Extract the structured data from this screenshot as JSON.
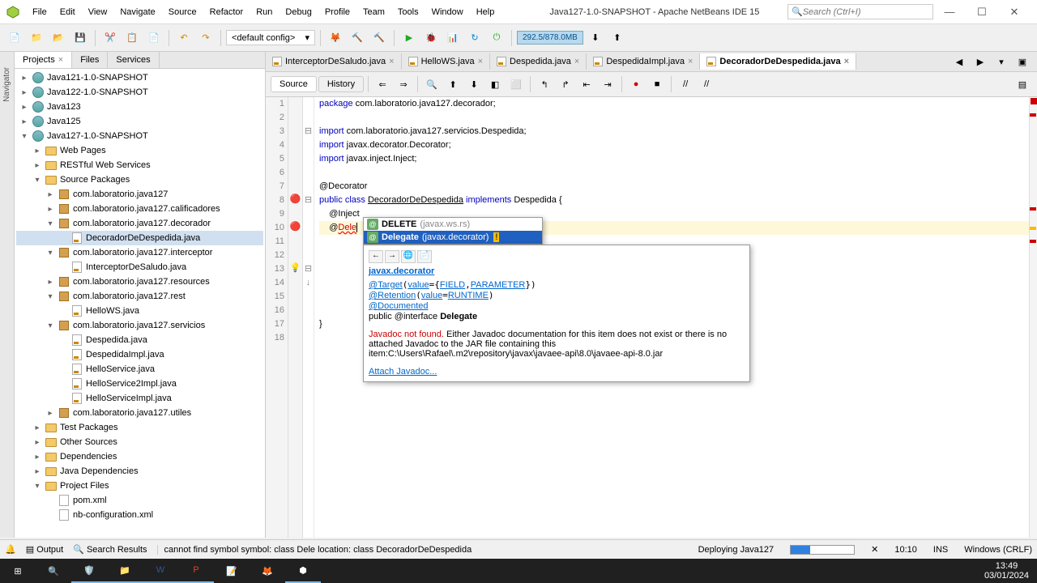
{
  "titlebar": {
    "menus": [
      "File",
      "Edit",
      "View",
      "Navigate",
      "Source",
      "Refactor",
      "Run",
      "Debug",
      "Profile",
      "Team",
      "Tools",
      "Window",
      "Help"
    ],
    "title": "Java127-1.0-SNAPSHOT - Apache NetBeans IDE 15",
    "search_placeholder": "Search (Ctrl+I)"
  },
  "toolbar": {
    "config": "<default config>",
    "memory": "292.5/878.0MB"
  },
  "panel_tabs": {
    "projects": "Projects",
    "files": "Files",
    "services": "Services"
  },
  "tree": [
    {
      "l": 0,
      "t": "e",
      "k": "proj",
      "n": "Java121-1.0-SNAPSHOT"
    },
    {
      "l": 0,
      "t": "e",
      "k": "proj",
      "n": "Java122-1.0-SNAPSHOT"
    },
    {
      "l": 0,
      "t": "e",
      "k": "proj",
      "n": "Java123"
    },
    {
      "l": 0,
      "t": "e",
      "k": "proj",
      "n": "Java125"
    },
    {
      "l": 0,
      "t": "o",
      "k": "proj",
      "n": "Java127-1.0-SNAPSHOT"
    },
    {
      "l": 1,
      "t": "e",
      "k": "folder",
      "n": "Web Pages"
    },
    {
      "l": 1,
      "t": "e",
      "k": "folder",
      "n": "RESTful Web Services"
    },
    {
      "l": 1,
      "t": "o",
      "k": "folder",
      "n": "Source Packages"
    },
    {
      "l": 2,
      "t": "e",
      "k": "pkg",
      "n": "com.laboratorio.java127"
    },
    {
      "l": 2,
      "t": "e",
      "k": "pkg",
      "n": "com.laboratorio.java127.calificadores"
    },
    {
      "l": 2,
      "t": "o",
      "k": "pkg",
      "n": "com.laboratorio.java127.decorador"
    },
    {
      "l": 3,
      "t": "",
      "k": "java",
      "n": "DecoradorDeDespedida.java",
      "sel": true
    },
    {
      "l": 2,
      "t": "o",
      "k": "pkg",
      "n": "com.laboratorio.java127.interceptor"
    },
    {
      "l": 3,
      "t": "",
      "k": "java",
      "n": "InterceptorDeSaludo.java"
    },
    {
      "l": 2,
      "t": "e",
      "k": "pkg",
      "n": "com.laboratorio.java127.resources"
    },
    {
      "l": 2,
      "t": "o",
      "k": "pkg",
      "n": "com.laboratorio.java127.rest"
    },
    {
      "l": 3,
      "t": "",
      "k": "java",
      "n": "HelloWS.java"
    },
    {
      "l": 2,
      "t": "o",
      "k": "pkg",
      "n": "com.laboratorio.java127.servicios"
    },
    {
      "l": 3,
      "t": "",
      "k": "java",
      "n": "Despedida.java"
    },
    {
      "l": 3,
      "t": "",
      "k": "java",
      "n": "DespedidaImpl.java"
    },
    {
      "l": 3,
      "t": "",
      "k": "java",
      "n": "HelloService.java"
    },
    {
      "l": 3,
      "t": "",
      "k": "java",
      "n": "HelloService2Impl.java"
    },
    {
      "l": 3,
      "t": "",
      "k": "java",
      "n": "HelloServiceImpl.java"
    },
    {
      "l": 2,
      "t": "e",
      "k": "pkg",
      "n": "com.laboratorio.java127.utiles"
    },
    {
      "l": 1,
      "t": "e",
      "k": "folder",
      "n": "Test Packages"
    },
    {
      "l": 1,
      "t": "e",
      "k": "folder",
      "n": "Other Sources"
    },
    {
      "l": 1,
      "t": "e",
      "k": "folder",
      "n": "Dependencies"
    },
    {
      "l": 1,
      "t": "e",
      "k": "folder",
      "n": "Java Dependencies"
    },
    {
      "l": 1,
      "t": "o",
      "k": "folder",
      "n": "Project Files"
    },
    {
      "l": 2,
      "t": "",
      "k": "xml",
      "n": "pom.xml"
    },
    {
      "l": 2,
      "t": "",
      "k": "xml",
      "n": "nb-configuration.xml"
    }
  ],
  "editor_tabs": [
    {
      "name": "InterceptorDeSaludo.java",
      "active": false
    },
    {
      "name": "HelloWS.java",
      "active": false
    },
    {
      "name": "Despedida.java",
      "active": false
    },
    {
      "name": "DespedidaImpl.java",
      "active": false
    },
    {
      "name": "DecoradorDeDespedida.java",
      "active": true
    }
  ],
  "editor_toolbar": {
    "source": "Source",
    "history": "History"
  },
  "code_lines": [
    "1",
    "2",
    "3",
    "4",
    "5",
    "6",
    "7",
    "8",
    "9",
    "10",
    "11",
    "12",
    "13",
    "14",
    "15",
    "16",
    "17",
    "18"
  ],
  "completion": {
    "item1": {
      "name": "DELETE",
      "pkg": "(javax.ws.rs)"
    },
    "item2": {
      "name": "Delegate",
      "pkg": "(javax.decorator)"
    }
  },
  "tooltip": {
    "pkg": "javax.decorator",
    "line1_a": "@Target",
    "line1_b": "value",
    "line1_c": "FIELD",
    "line1_d": "PARAMETER",
    "line2_a": "@Retention",
    "line2_b": "value",
    "line2_c": "RUNTIME",
    "line3": "@Documented",
    "line4_a": "public @interface ",
    "line4_b": "Delegate",
    "notfound": "Javadoc not found.",
    "body": " Either Javadoc documentation for this item does not exist or there is no attached Javadoc to the JAR file containing this item:C:\\Users\\Rafael\\.m2\\repository\\javax\\javaee-api\\8.0\\javaee-api-8.0.jar",
    "attach": "Attach Javadoc..."
  },
  "statusbar": {
    "output": "Output",
    "search": "Search Results",
    "err": "cannot find symbol   symbol:   class Dele   location: class DecoradorDeDespedida",
    "deploy": "Deploying Java127",
    "pos": "10:10",
    "ins": "INS",
    "os": "Windows (CRLF)"
  },
  "taskbar": {
    "time": "13:49",
    "date": "03/01/2024"
  }
}
